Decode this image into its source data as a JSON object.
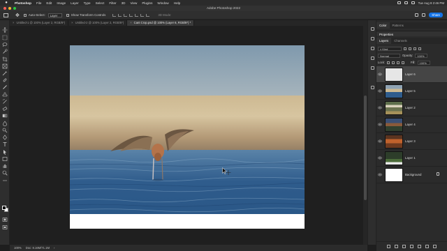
{
  "os_menubar": {
    "apple": "",
    "items": [
      "Photoshop",
      "File",
      "Edit",
      "Image",
      "Layer",
      "Type",
      "Select",
      "Filter",
      "3D",
      "View",
      "Plugins",
      "Window",
      "Help"
    ],
    "datetime": "Tue Aug 8  2:46 PM"
  },
  "app": {
    "title": "Adobe Photoshop 2022"
  },
  "options": {
    "auto_select_label": "Auto-Select:",
    "auto_select_value": "Layer",
    "show_transform_label": "Show Transform Controls",
    "mode_3d_label": "3D Mode:",
    "share_label": "Share"
  },
  "tabs": [
    {
      "label": "Untitled-1 @ 100% (Layer 2, RGB/8*)",
      "active": false
    },
    {
      "label": "Untitled-2 @ 100% (Layer 2, RGB/8*)",
      "active": false
    },
    {
      "label": "Cant Crop.psd @ 100% (Layer 6, RGB/8*) *",
      "active": true
    }
  ],
  "status": {
    "zoom": "100%",
    "doc": "Doc: 8.16M/71.1M"
  },
  "panels": {
    "tabs_top": [
      "Color",
      "Patterns"
    ],
    "properties_tab": "Properties",
    "layers_tabs": [
      "Layers",
      "Channels"
    ],
    "kind_filter": "Kind",
    "blend_mode": "Normal",
    "opacity_label": "Opacity:",
    "opacity_value": "100%",
    "lock_label": "Lock:",
    "fill_label": "Fill:",
    "fill_value": "100%",
    "layers": [
      {
        "name": "Layer 6",
        "selected": true
      },
      {
        "name": "Layer 5",
        "selected": false
      },
      {
        "name": "Layer 2",
        "selected": false
      },
      {
        "name": "Layer 4",
        "selected": false
      },
      {
        "name": "Layer 3",
        "selected": false
      },
      {
        "name": "Layer 1",
        "selected": false
      },
      {
        "name": "Background",
        "selected": false
      }
    ]
  },
  "colors": {
    "accent": "#1473e6",
    "panel_bg": "#2b2b2b",
    "canvas_bg": "#1f1f1f"
  }
}
